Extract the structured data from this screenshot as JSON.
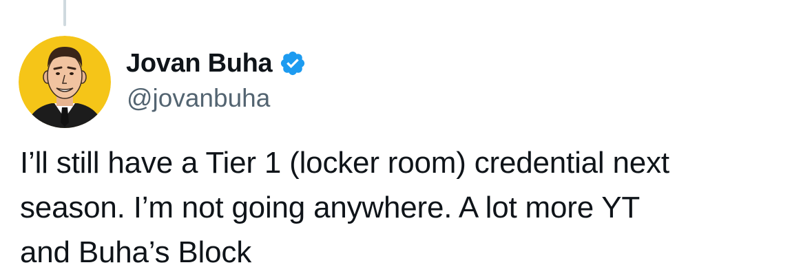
{
  "author": {
    "display_name": "Jovan Buha",
    "handle": "@jovanbuha",
    "verified": true,
    "avatar_icon": "cartoon-portrait-avatar",
    "verified_icon": "blue-check-badge-icon",
    "verified_color": "#1d9bf0"
  },
  "tweet": {
    "text": "I’ll still have a Tier 1 (locker room) credential next\nseason. I’m not going anywhere. A lot more YT\nand Buha’s Block"
  },
  "colors": {
    "text_primary": "#0f1419",
    "text_secondary": "#536471",
    "thread_line": "#cfd9de",
    "avatar_background": "#f5c518"
  }
}
